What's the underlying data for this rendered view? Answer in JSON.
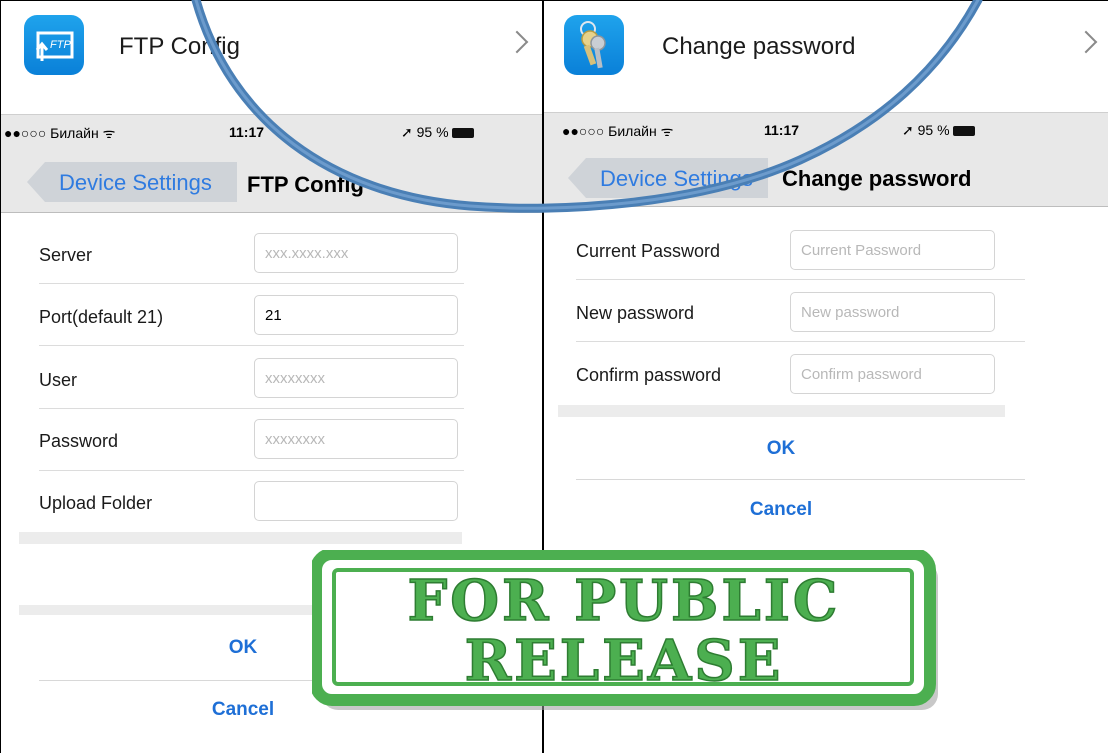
{
  "left_screen": {
    "header": {
      "title": "FTP Config",
      "icon": "ftp-icon",
      "icon_text": "FTP",
      "chevron": "chevron-right-icon"
    },
    "status_bar": {
      "carrier": "●●○○○ Билайн ᯤ",
      "time": "11:17",
      "battery": "➚ 95 %"
    },
    "nav": {
      "back_label": "Device Settings",
      "title": "FTP Config"
    },
    "fields": [
      {
        "label": "Server",
        "placeholder": "xxx.xxxx.xxx",
        "value": ""
      },
      {
        "label": "Port(default 21)",
        "placeholder": "",
        "value": "21"
      },
      {
        "label": "User",
        "placeholder": "xxxxxxxx",
        "value": ""
      },
      {
        "label": "Password",
        "placeholder": "xxxxxxxx",
        "value": ""
      },
      {
        "label": "Upload Folder",
        "placeholder": "",
        "value": ""
      }
    ],
    "ok_label": "OK",
    "cancel_label": "Cancel"
  },
  "right_screen": {
    "header": {
      "title": "Change password",
      "icon": "keys-icon",
      "chevron": "chevron-right-icon"
    },
    "status_bar": {
      "carrier": "●●○○○ Билайн ᯤ",
      "time": "11:17",
      "battery": "➚ 95 %"
    },
    "nav": {
      "back_label": "Device Settings",
      "title": "Change password"
    },
    "fields": [
      {
        "label": "Current Password",
        "placeholder": "Current Password",
        "value": ""
      },
      {
        "label": "New password",
        "placeholder": "New password",
        "value": ""
      },
      {
        "label": "Confirm password",
        "placeholder": "Confirm password",
        "value": ""
      }
    ],
    "ok_label": "OK",
    "cancel_label": "Cancel"
  },
  "stamp": {
    "line1": "FOR PUBLIC",
    "line2": "RELEASE",
    "color": "#4caf50"
  },
  "colors": {
    "link_blue": "#1e6fd6",
    "nav_bg": "#e8e8e8",
    "app_icon_blue": "#1296e6",
    "arc_blue": "#4a7fb5"
  }
}
